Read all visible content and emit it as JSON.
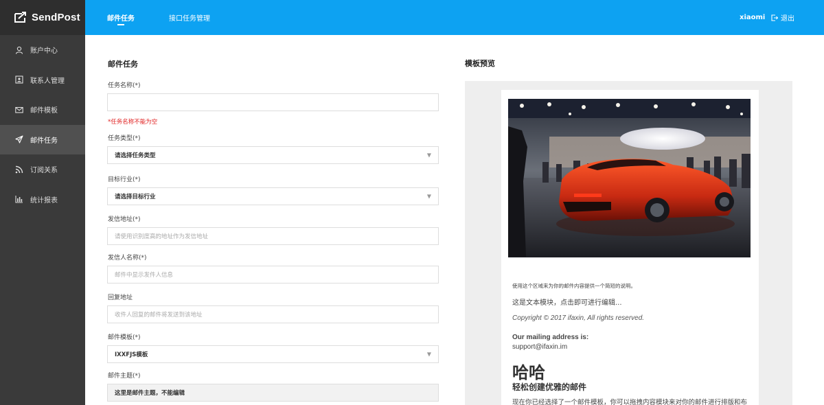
{
  "app": {
    "brand": "SendPost"
  },
  "sidebar": {
    "items": [
      {
        "label": "账户中心",
        "icon": "user-icon",
        "active": false
      },
      {
        "label": "联系人管理",
        "icon": "contact-card-icon",
        "active": false
      },
      {
        "label": "邮件模板",
        "icon": "envelope-icon",
        "active": false
      },
      {
        "label": "邮件任务",
        "icon": "paper-plane-icon",
        "active": true
      },
      {
        "label": "订阅关系",
        "icon": "rss-icon",
        "active": false
      },
      {
        "label": "统计报表",
        "icon": "bar-chart-icon",
        "active": false
      }
    ]
  },
  "topbar": {
    "tabs": [
      {
        "label": "邮件任务",
        "active": true
      },
      {
        "label": "接口任务管理",
        "active": false
      }
    ],
    "username": "xiaomi",
    "logout_label": "退出",
    "color": "#0da2f2"
  },
  "form": {
    "title": "邮件任务",
    "task_name": {
      "label": "任务名称(*)",
      "value": "",
      "error": "*任务名称不能为空"
    },
    "task_type": {
      "label": "任务类型(*)",
      "value": "请选择任务类型"
    },
    "industry": {
      "label": "目标行业(*)",
      "value": "请选择目标行业"
    },
    "sender_address": {
      "label": "发信地址(*)",
      "placeholder": "请使用识别度高的地址作为发信地址"
    },
    "sender_name": {
      "label": "发信人名称(*)",
      "placeholder": "邮件中显示发件人信息"
    },
    "reply_address": {
      "label": "回复地址",
      "placeholder": "收件人回复的邮件将发送到该地址"
    },
    "template": {
      "label": "邮件模板(*)",
      "value": "IXXFJS模板"
    },
    "subject": {
      "label": "邮件主题(*)",
      "value": "这里是邮件主题，不能编辑"
    }
  },
  "preview": {
    "title": "模板预览",
    "intro": "使用这个区域来为你的邮件内容提供一个简短的说明。",
    "text_module": "这是文本模块，点击即可进行编辑...",
    "copyright": "Copyright © 2017 ifaxin, All rights reserved.",
    "mailing_label": "Our mailing address is:",
    "mailing_address": "support@ifaxin.im",
    "heading": "哈哈",
    "subheading": "轻松创建优雅的邮件",
    "body": "现在你已经选择了一个邮件模板，你可以拖拽内容模块来对你的邮件进行排版和布"
  }
}
